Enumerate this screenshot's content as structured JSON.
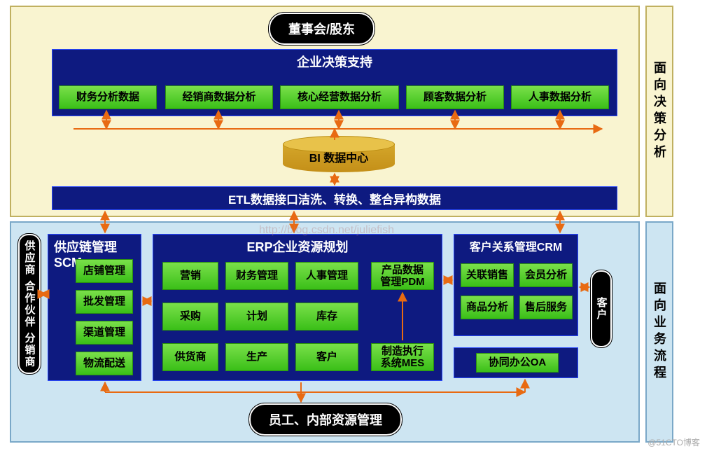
{
  "top_pill": "董事会/股东",
  "bot_pill": "员工、内部资源管理",
  "side_top": "面向决策分析",
  "side_bot": "面向业务流程",
  "decision_panel": {
    "title": "企业决策支持"
  },
  "decision_nodes": [
    "财务分析数据",
    "经销商数据分析",
    "核心经营数据分析",
    "顾客数据分析",
    "人事数据分析"
  ],
  "bi": "BI 数据中心",
  "etl": "ETL数据接口洁洗、转换、整合异构数据",
  "scm": {
    "title": "供应链管理SCM",
    "items": [
      "店铺管理",
      "批发管理",
      "渠道管理",
      "物流配送"
    ]
  },
  "erp": {
    "title": "ERP企业资源规划",
    "grid": [
      "营销",
      "财务管理",
      "人事管理",
      "采购",
      "计划",
      "库存",
      "供货商",
      "生产",
      "客户"
    ],
    "pdm": "产品数据\n管理PDM",
    "mes": "制造执行\n系统MES"
  },
  "crm": {
    "title": "客户关系管理CRM",
    "items": [
      "关联销售",
      "会员分析",
      "商品分析",
      "售后服务"
    ]
  },
  "oa": "协同办公OA",
  "vpill_left": "供应商 合作伙伴 分销商",
  "vpill_right": "客户",
  "watermark": "http://blog.csdn.net/juliefish",
  "credit": "@51CTO博客"
}
